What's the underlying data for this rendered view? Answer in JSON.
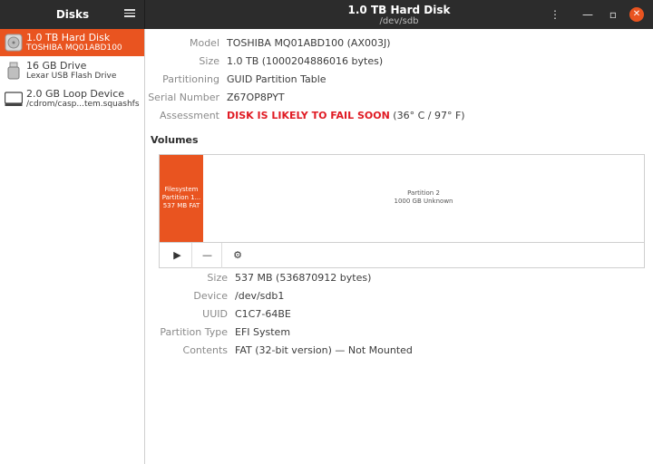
{
  "app": {
    "title": "Disks",
    "window_title": "1.0 TB Hard Disk",
    "window_subtitle": "/dev/sdb"
  },
  "colors": {
    "accent": "#e95420",
    "warning": "#e01b24",
    "headerbar": "#2c2c2c"
  },
  "sidebar": {
    "drives": [
      {
        "name": "1.0 TB Hard Disk",
        "subtitle": "TOSHIBA MQ01ABD100",
        "icon": "hard-disk-icon",
        "selected": true
      },
      {
        "name": "16 GB Drive",
        "subtitle": "Lexar USB Flash Drive",
        "icon": "usb-drive-icon",
        "selected": false
      },
      {
        "name": "2.0 GB Loop Device",
        "subtitle": "/cdrom/casp...tem.squashfs",
        "icon": "loop-device-icon",
        "selected": false
      }
    ]
  },
  "disk": {
    "model_label": "Model",
    "model": "TOSHIBA MQ01ABD100 (AX003J)",
    "size_label": "Size",
    "size": "1.0 TB (1000204886016 bytes)",
    "partitioning_label": "Partitioning",
    "partitioning": "GUID Partition Table",
    "serial_label": "Serial Number",
    "serial": "Z67OP8PYT",
    "assessment_label": "Assessment",
    "assessment_warning": "DISK IS LIKELY TO FAIL SOON",
    "assessment_temp": " (36° C / 97° F)"
  },
  "volumes": {
    "heading": "Volumes",
    "partitions": [
      {
        "line1": "Filesystem",
        "line2": "Partition 1...",
        "line3": "537 MB FAT"
      },
      {
        "line1": "Partition 2",
        "line2": "1000 GB Unknown"
      }
    ],
    "toolbar": {
      "play": "▶",
      "minus": "—",
      "gear": "⚙"
    }
  },
  "partition": {
    "size_label": "Size",
    "size": "537 MB (536870912 bytes)",
    "device_label": "Device",
    "device": "/dev/sdb1",
    "uuid_label": "UUID",
    "uuid": "C1C7-64BE",
    "type_label": "Partition Type",
    "type": "EFI System",
    "contents_label": "Contents",
    "contents": "FAT (32-bit version) — Not Mounted"
  }
}
